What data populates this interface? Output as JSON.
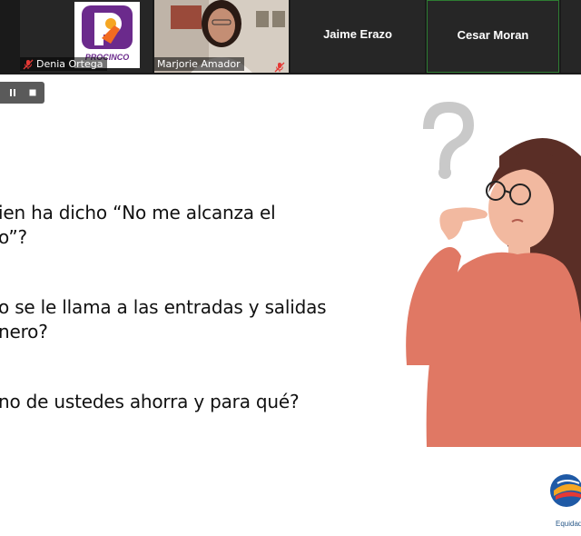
{
  "participants": [
    {
      "name": "Denia Ortega",
      "muted": true
    },
    {
      "name": "Marjorie Amador",
      "muted": true
    },
    {
      "name": "Jaime Erazo"
    },
    {
      "name": "Cesar Moran"
    }
  ],
  "logo_text": "PROCINCO",
  "slide": {
    "questions": [
      {
        "line1": "ien ha dicho “No me alcanza el",
        "line2": "o”?"
      },
      {
        "line1": "o se le llama a las entradas y salidas",
        "line2": "nero?"
      },
      {
        "line1": "no de ustedes ahorra y para qué?"
      }
    ],
    "footer_brand": "Equidad"
  },
  "colors": {
    "active_speaker_border": "#2e7d32",
    "mute_icon": "#e53935",
    "woman_shirt": "#e07864",
    "woman_hair": "#5a2e26",
    "question_mark": "#c4c4c4"
  },
  "icons": [
    "mic-muted-icon",
    "pause-icon",
    "stop-icon",
    "question-mark-icon",
    "thinking-woman-illustration",
    "brand-logo-icon"
  ]
}
